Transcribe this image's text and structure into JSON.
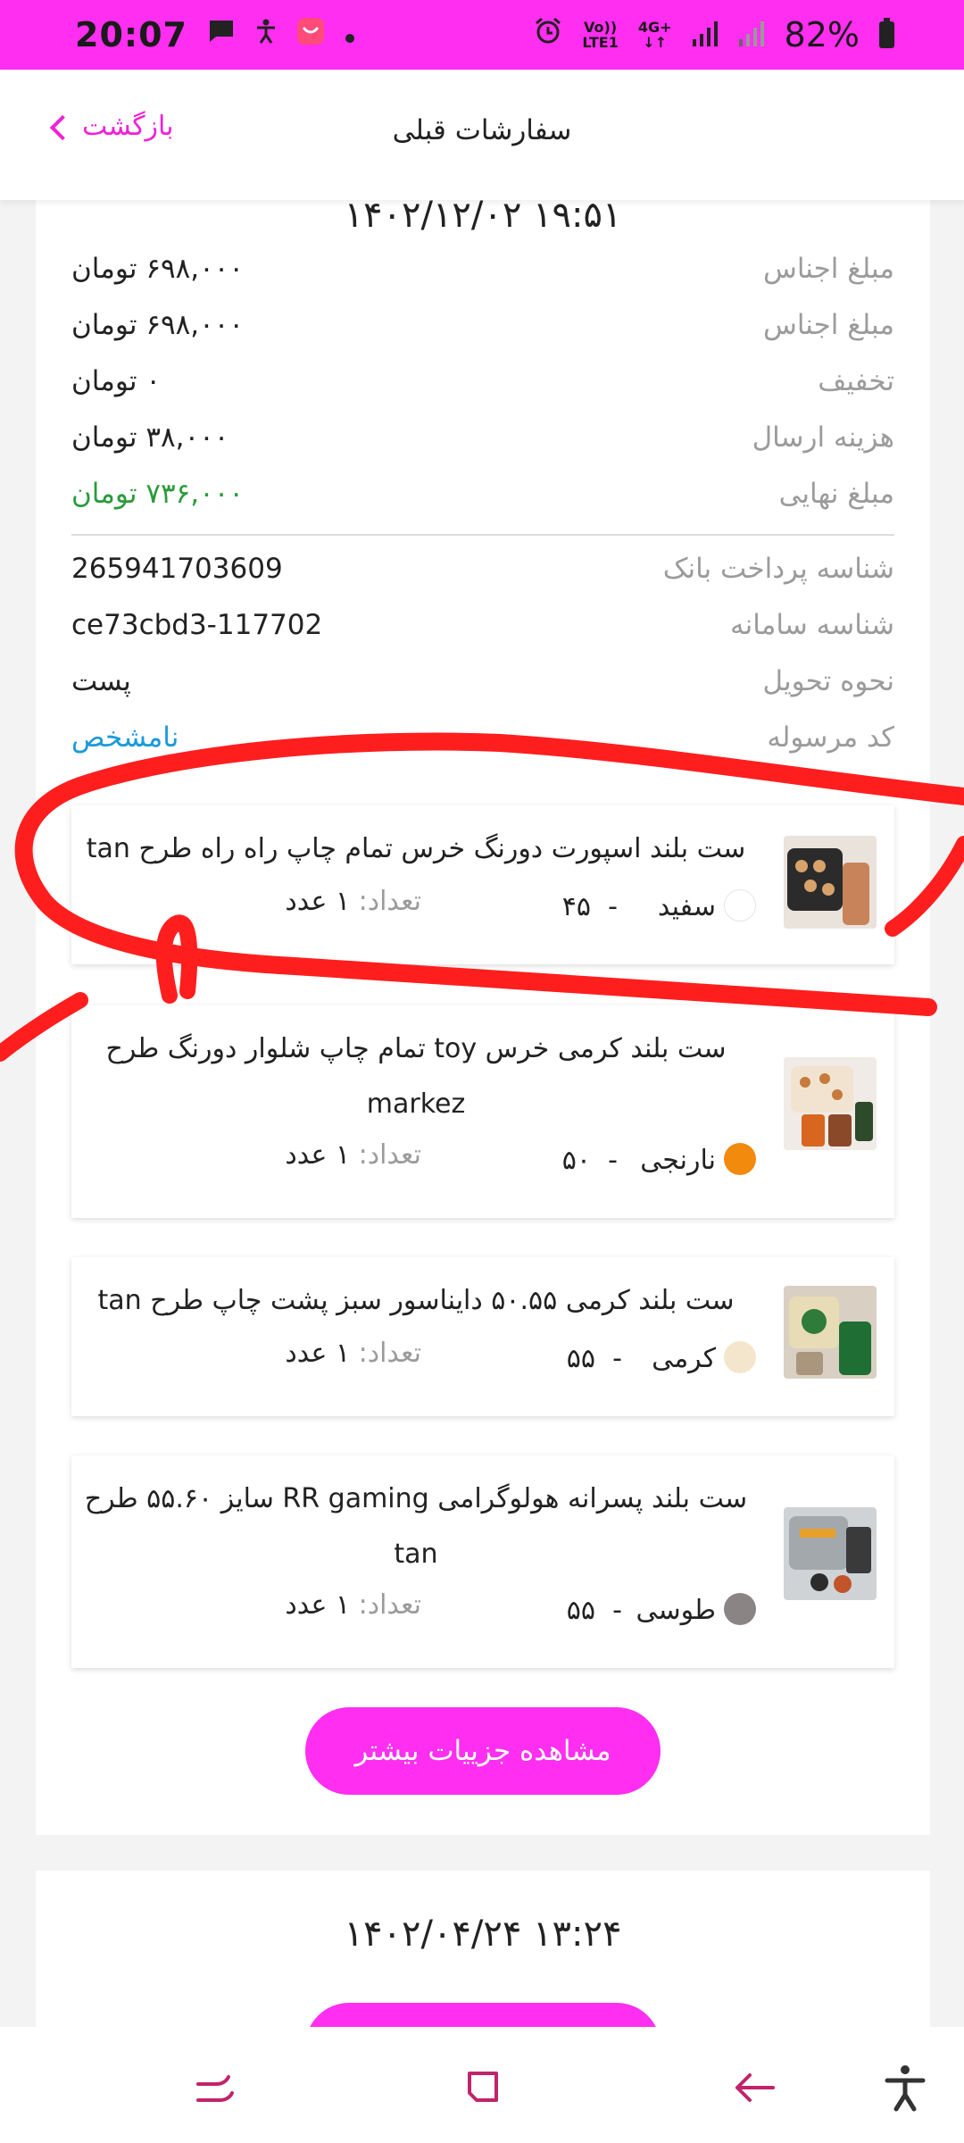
{
  "status_bar": {
    "time": "20:07",
    "network_top": "Vo))",
    "network_bottom": "LTE1",
    "signal_type": "4G+",
    "battery": "82%"
  },
  "header": {
    "title": "سفارشات قبلی",
    "back_label": "بازگشت"
  },
  "order1": {
    "date": "۱۴۰۲/۱۲/۰۲ ۱۹:۵۱",
    "rows": [
      {
        "label": "مبلغ اجناس",
        "value": "۶۹۸,۰۰۰ تومان"
      },
      {
        "label": "مبلغ اجناس",
        "value": "۶۹۸,۰۰۰ تومان"
      },
      {
        "label": "تخفیف",
        "value": "۰ تومان"
      },
      {
        "label": "هزینه ارسال",
        "value": "۳۸,۰۰۰ تومان"
      },
      {
        "label": "مبلغ نهایی",
        "value": "۷۳۶,۰۰۰ تومان"
      }
    ],
    "rows2": [
      {
        "label": "شناسه پرداخت بانک",
        "value": "265941703609"
      },
      {
        "label": "شناسه سامانه",
        "value": "ce73cbd3-117702"
      },
      {
        "label": "نحوه تحویل",
        "value": "پست"
      },
      {
        "label": "کد مرسوله",
        "value": "نامشخص"
      }
    ],
    "items": [
      {
        "title": "ست بلند اسپورت دورنگ خرس تمام چاپ راه راه طرح tan",
        "color_name": "سفید",
        "size": "۴۵",
        "qty_label": "تعداد:",
        "qty_value": "۱ عدد",
        "swatch": "#ffffff"
      },
      {
        "title": "ست بلند کرمی خرس toy تمام چاپ شلوار دورنگ طرح markez",
        "color_name": "نارنجی",
        "size": "۵۰",
        "qty_label": "تعداد:",
        "qty_value": "۱ عدد",
        "swatch": "#f28a0e"
      },
      {
        "title": "ست بلند کرمی ۵۰.۵۵ دایناسور سبز پشت چاپ طرح tan",
        "color_name": "کرمی",
        "size": "۵۵",
        "qty_label": "تعداد:",
        "qty_value": "۱ عدد",
        "swatch": "#f3e6cd"
      },
      {
        "title": "ست بلند پسرانه هولوگرامی RR gaming سایز ۵۵.۶۰ طرح tan",
        "color_name": "طوسی",
        "size": "۵۵",
        "qty_label": "تعداد:",
        "qty_value": "۱ عدد",
        "swatch": "#8a8485"
      }
    ],
    "more_button": "مشاهده جزییات بیشتر"
  },
  "order2": {
    "date": "۱۴۰۲/۰۴/۲۴ ۱۳:۲۴"
  },
  "colors": {
    "accent": "#ff2ef0",
    "green": "#2a9b3b",
    "link_blue": "#1b9ad9",
    "annotation": "#ff1e1e"
  }
}
